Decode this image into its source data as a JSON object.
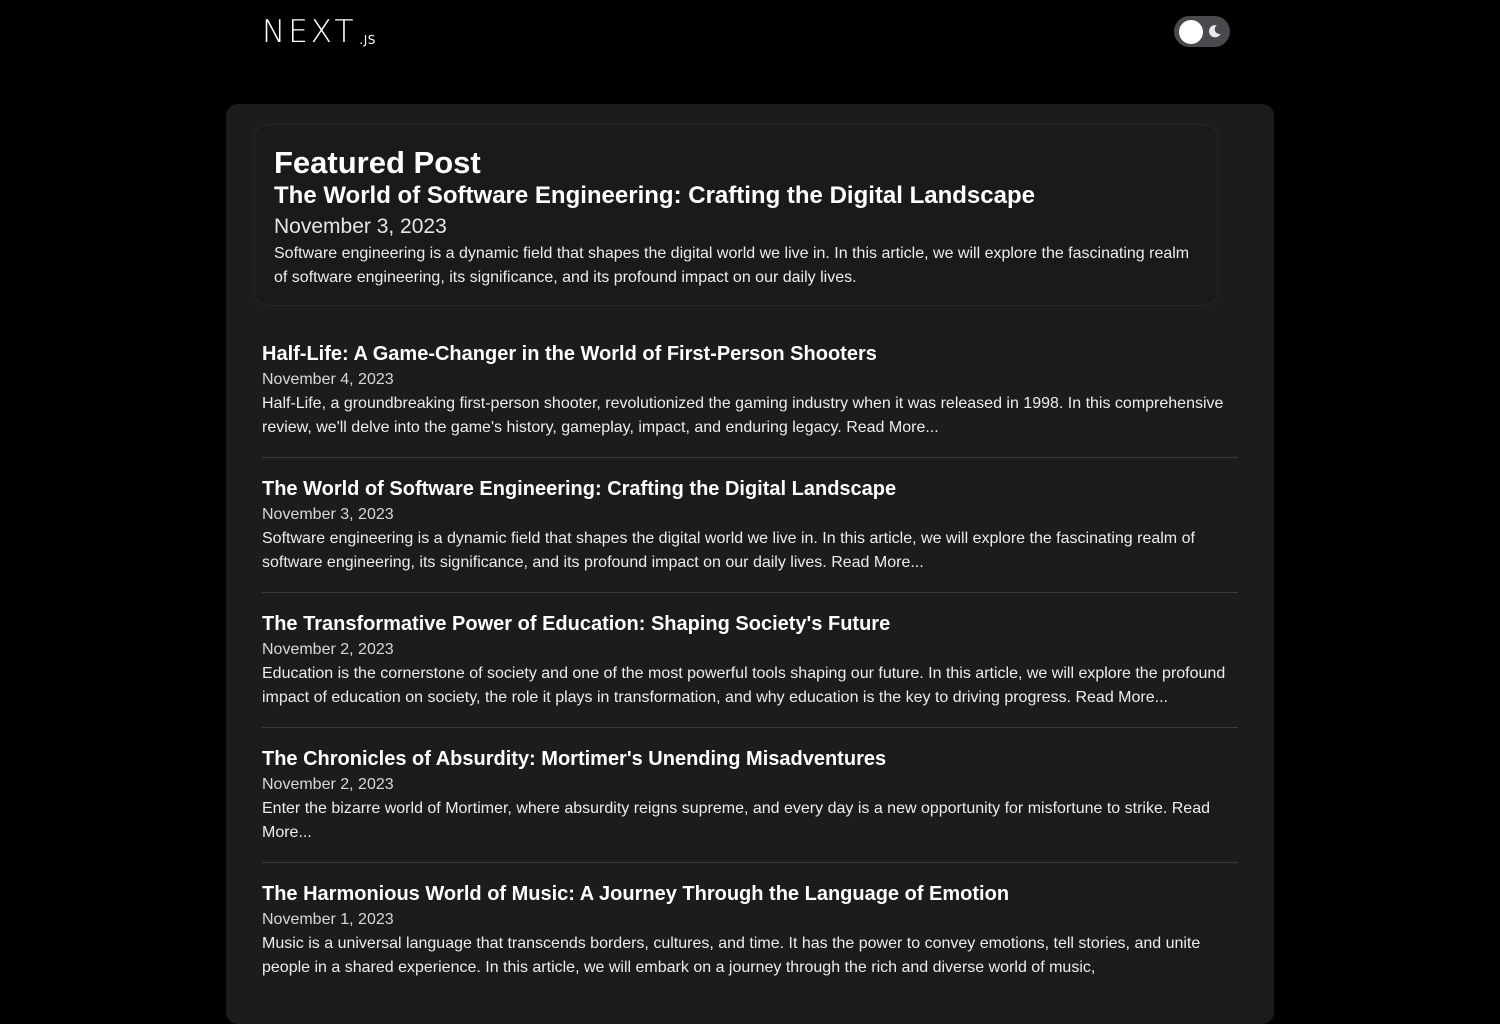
{
  "header": {
    "logo_main": "NEXT",
    "logo_sub": ".JS",
    "theme_toggle_icon": "moon-icon",
    "toggle_color": "#4a4a4e"
  },
  "featured": {
    "heading": "Featured Post",
    "title": "The World of Software Engineering: Crafting the Digital Landscape",
    "date": "November 3, 2023",
    "excerpt": "Software engineering is a dynamic field that shapes the digital world we live in. In this article, we will explore the fascinating realm of software engineering, its significance, and its profound impact on our daily lives."
  },
  "posts": [
    {
      "title": "Half-Life: A Game-Changer in the World of First-Person Shooters",
      "date": "November 4, 2023",
      "excerpt": "Half-Life, a groundbreaking first-person shooter, revolutionized the gaming industry when it was released in 1998. In this comprehensive review, we'll delve into the game's history, gameplay, impact, and enduring legacy.",
      "read_more": "Read More..."
    },
    {
      "title": "The World of Software Engineering: Crafting the Digital Landscape",
      "date": "November 3, 2023",
      "excerpt": "Software engineering is a dynamic field that shapes the digital world we live in. In this article, we will explore the fascinating realm of software engineering, its significance, and its profound impact on our daily lives.",
      "read_more": "Read More..."
    },
    {
      "title": "The Transformative Power of Education: Shaping Society's Future",
      "date": "November 2, 2023",
      "excerpt": "Education is the cornerstone of society and one of the most powerful tools shaping our future. In this article, we will explore the profound impact of education on society, the role it plays in transformation, and why education is the key to driving progress.",
      "read_more": "Read More..."
    },
    {
      "title": "The Chronicles of Absurdity: Mortimer's Unending Misadventures",
      "date": "November 2, 2023",
      "excerpt": "Enter the bizarre world of Mortimer, where absurdity reigns supreme, and every day is a new opportunity for misfortune to strike.",
      "read_more": "Read More..."
    },
    {
      "title": "The Harmonious World of Music: A Journey Through the Language of Emotion",
      "date": "November 1, 2023",
      "excerpt": "Music is a universal language that transcends borders, cultures, and time. It has the power to convey emotions, tell stories, and unite people in a shared experience. In this article, we will embark on a journey through the rich and diverse world of music,",
      "read_more": ""
    }
  ]
}
